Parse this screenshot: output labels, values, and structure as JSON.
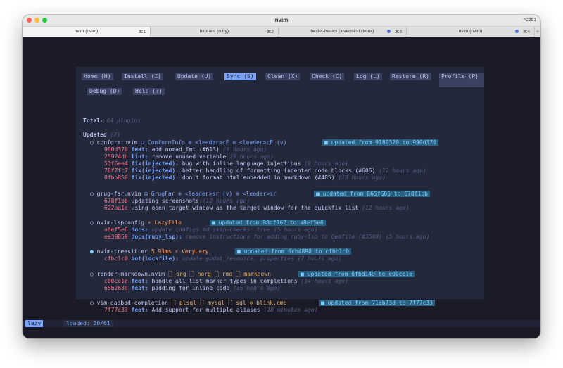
{
  "window": {
    "title": "nvim",
    "shortcut": "⌥⌘1"
  },
  "tabs": [
    {
      "label": "nvim (nvim)",
      "key": "⌘1",
      "dot": false
    },
    {
      "label": "bin/rails (ruby)",
      "key": "⌘2",
      "dot": false
    },
    {
      "label": "hexlet-basics | overmind (tmux)",
      "key": "⌘3",
      "dot": true
    },
    {
      "label": "nvim (nvim)",
      "key": "⌘4",
      "dot": true
    }
  ],
  "tab_add": "+",
  "menu": [
    "Home (H)",
    "Install (I)",
    "Update (U)",
    "Sync (S)",
    "Clean (X)",
    "Check (C)",
    "Log (L)",
    "Restore (R)",
    "Profile (P)",
    "Debug (D)",
    "Help (?)"
  ],
  "total": {
    "label": "Total:",
    "value": "64 plugins"
  },
  "section": {
    "label": "Updated",
    "count": "(7)"
  },
  "plugins": [
    {
      "bullet": "○",
      "name": "conform.nvim",
      "tags": "☊ ConformInfo ⊕ <leader>cF ⊕ <leader>cF (v)",
      "badge": "■ updated from 9180320 to 990d370",
      "commits": [
        {
          "hash": "990d370",
          "type": "feat:",
          "msg": "add nomad_fmt (#613)",
          "time": "(9 hours ago)"
        },
        {
          "hash": "25924db",
          "type": "lint:",
          "msg": "remove unused variable",
          "time": "(9 hours ago)"
        },
        {
          "hash": "53f6ae4",
          "type": "fix(injected):",
          "msg": "bug with inline language injections",
          "time": "(9 hours ago)"
        },
        {
          "hash": "78f7fc7",
          "type": "fix(injected):",
          "msg": "better handling of formatting indented code blocks (#606)",
          "time": "(12 hours ago)"
        },
        {
          "hash": "0fbb850",
          "type": "fix(injected):",
          "msg": "don't format html embedded in markdown (#485)",
          "time": "(13 hours ago)"
        }
      ]
    },
    {
      "bullet": "○",
      "name": "grug-far.nvim",
      "tags": "☊ GrugFar ⊕ <leader>sr (v) ⊕ <leader>sr",
      "badge": "■ updated from 865f665 to 678f1bb",
      "commits": [
        {
          "hash": "678f1bb",
          "type": "",
          "msg": "updating screenshots",
          "time": "(12 hours ago)"
        },
        {
          "hash": "622ba1c",
          "type": "",
          "msg": "using open target window as the target window for the quickfix list",
          "time": "(12 hours ago)"
        }
      ]
    },
    {
      "bullet": "○",
      "name": "nvim-lspconfig",
      "tags": "⚡ LazyFile",
      "badge": "■ updated from 88df162 to a8ef5e6",
      "commits": [
        {
          "hash": "a8ef5e6",
          "type": "docs:",
          "msg": "update configs.md skip-checks: true",
          "time": "(5 hours ago)"
        },
        {
          "hash": "ee39859",
          "type": "docs(ruby_lsp):",
          "msg": "remove instructions for adding ruby-lsp to Gemfile (#3540)",
          "time": "(5 hours ago)"
        }
      ]
    },
    {
      "bullet": "●",
      "name": "nvim-treesitter",
      "tags": "5.93ms ⚡ VeryLazy",
      "badge": "■ updated from 6cb4898 to cfbc1c0",
      "commits": [
        {
          "hash": "cfbc1c0",
          "type": "bot(lockfile):",
          "msg": "update godot_resource, properties",
          "time": "(7 hours ago)"
        }
      ]
    },
    {
      "bullet": "○",
      "name": "render-markdown.nvim",
      "tags": "🗋 org 🗋 norg 🗋 rmd 🗋 markdown",
      "badge": "■ updated from 6fbd149 to c00cc1e",
      "commits": [
        {
          "hash": "c00cc1e",
          "type": "feat:",
          "msg": "handle all list marker types in completions",
          "time": "(14 hours ago)"
        },
        {
          "hash": "65b263d",
          "type": "feat:",
          "msg": "padding for inline code",
          "time": "(15 hours ago)"
        }
      ]
    },
    {
      "bullet": "○",
      "name": "vim-dadbod-completion",
      "tags": "🗋 plsql 🗋 mysql 🗋 sql ⊕ blink.cmp",
      "badge": "■ updated from 71eb73d to 7f77c33",
      "commits": [
        {
          "hash": "7f77c33",
          "type": "feat:",
          "msg": "Add support for multiple aliases",
          "time": "(18 minutes ago)"
        }
      ]
    }
  ],
  "status": {
    "mode": "lazy",
    "sep": "",
    "text": "loaded: 20/61"
  },
  "colors": {
    "accent": "#7aa2f7",
    "background": "#1a1b26",
    "panel": "#24283b",
    "badge": "#2a5f80"
  }
}
